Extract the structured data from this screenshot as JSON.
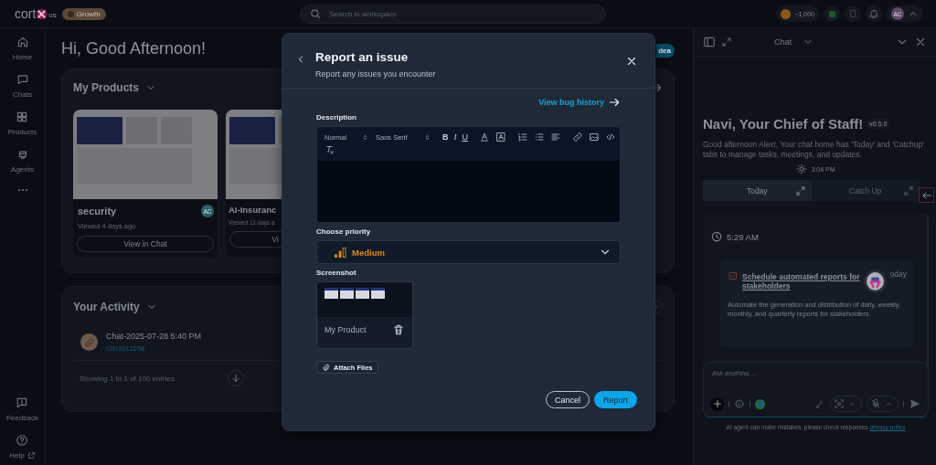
{
  "top_bar": {
    "logo_text": "cort",
    "logo_suffix": "us",
    "plan": "Growth",
    "search": {
      "placeholder": "Search in workspace"
    },
    "credits": "~1,000",
    "avatar": "AC"
  },
  "nav": {
    "items": [
      {
        "label": "Home",
        "kind": "home"
      },
      {
        "label": "Chats",
        "kind": "chat"
      },
      {
        "label": "Products",
        "kind": "grid"
      },
      {
        "label": "Agents",
        "kind": "agent"
      },
      {
        "kind": "more"
      }
    ],
    "bottom": [
      {
        "label": "Feedback",
        "kind": "feedback"
      },
      {
        "label": "Help",
        "kind": "help"
      }
    ]
  },
  "main": {
    "greeting": "Hi, Good Afternoon!",
    "header_button": "dea",
    "products": {
      "title": "My Products",
      "cards": [
        {
          "name": "security",
          "viewed": "Viewed 4 days ago",
          "button": "View in Chat",
          "avatar": "AC"
        },
        {
          "name": "AI-Insuranc",
          "viewed": "Viewed 11 days a",
          "button": "Vi"
        }
      ]
    },
    "activity": {
      "title": "Your Activity",
      "items": [
        {
          "title": "Chat-2025-07-28 5:40 PM",
          "id": "CID1012158"
        }
      ],
      "footer": "Showing 1 to 1 of 100 entries"
    }
  },
  "dialog": {
    "title": "Report an issue",
    "subtitle": "Report any issues you encounter",
    "history_link": "View bug history",
    "description": {
      "label": "Description",
      "format": "Normal",
      "font": "Sans Serif",
      "marks": [
        "B",
        "I",
        "U"
      ]
    },
    "priority": {
      "label": "Choose priority",
      "value": "Medium"
    },
    "screenshot": {
      "label": "Screenshot",
      "name": "My Product"
    },
    "attach": "Attach Files",
    "cancel": "Cancel",
    "submit": "Report"
  },
  "chat": {
    "title": "Chat",
    "heading": "Navi, Your Chief of Staff!",
    "version": "v0.5.0",
    "intro": "Good afternoon Alex!, Your chat home has 'Today' and 'Catchup' tabs to manage tasks, meetings, and updates.",
    "time": "3:04 PM",
    "tabs": [
      {
        "label": "Today",
        "selected": true
      },
      {
        "label": "Catch Up",
        "selected": false
      }
    ],
    "feed": {
      "time": "5:29 AM",
      "task": {
        "title": "Schedule automated reports for stakeholders",
        "tag": "oday",
        "detail": "Automate the generation and distribution of daily, weekly, monthly, and quarterly reports for stakeholders."
      }
    },
    "input": {
      "placeholder": "Ask anything...."
    },
    "disclaimer": "AI agent can make mistakes, please check responses",
    "policy_link": "privacy policy"
  }
}
